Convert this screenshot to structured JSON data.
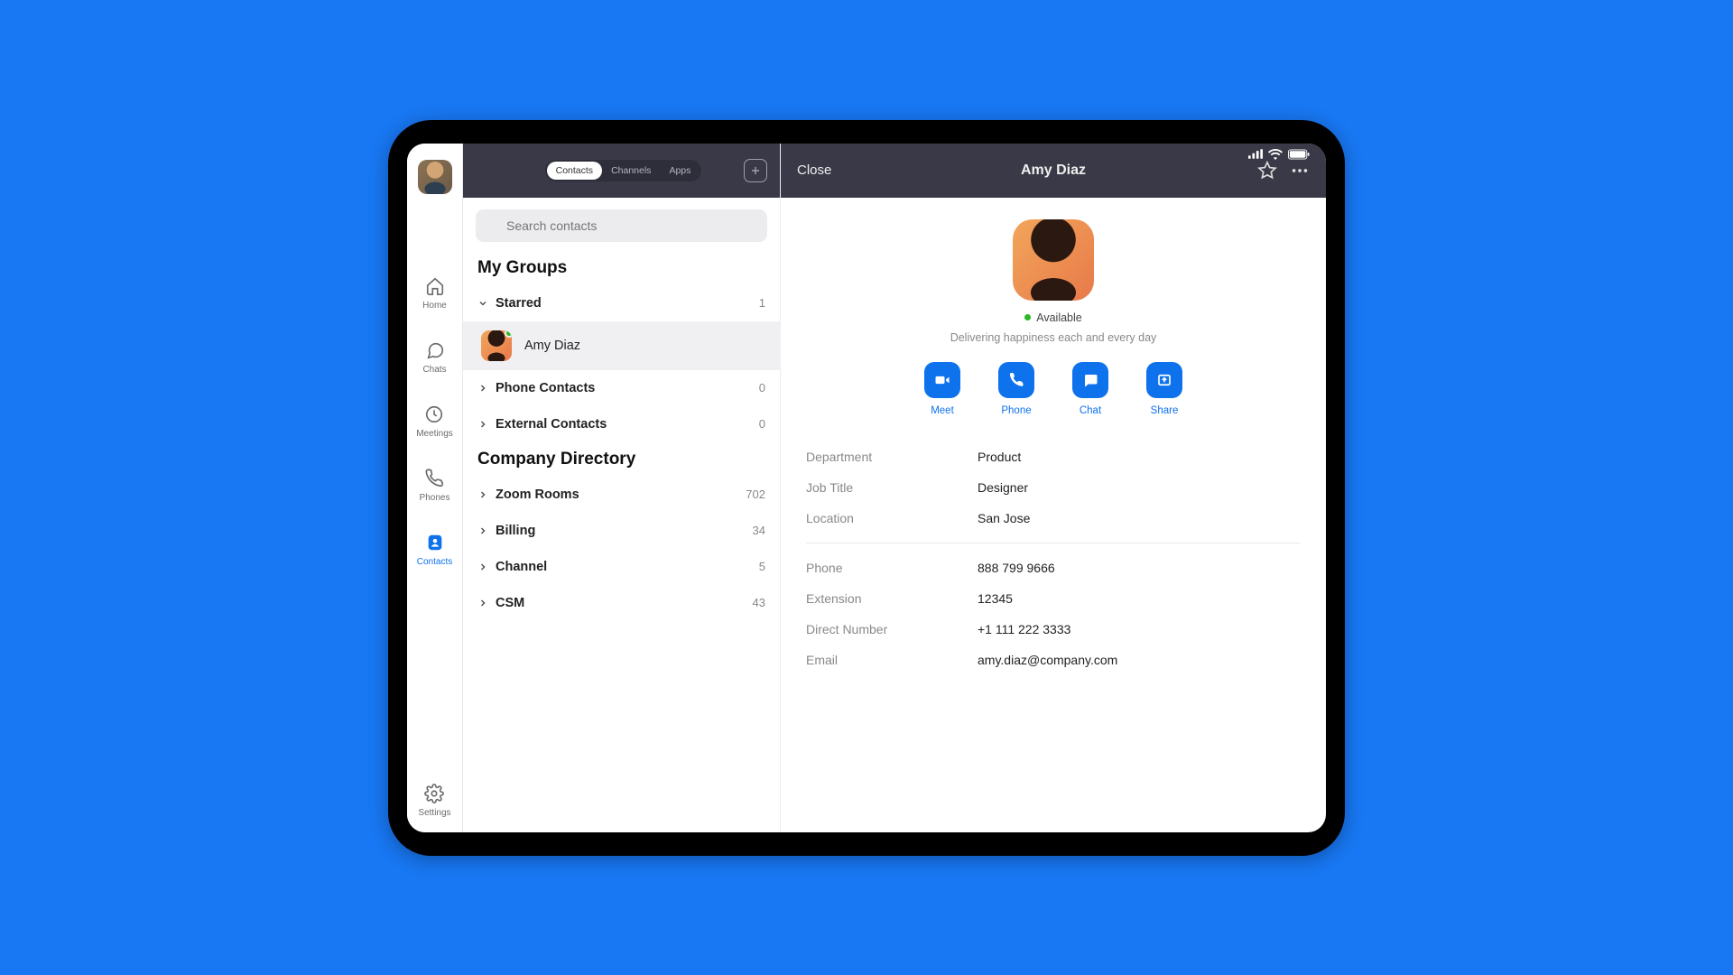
{
  "nav": {
    "items": [
      {
        "label": "Home"
      },
      {
        "label": "Chats"
      },
      {
        "label": "Meetings"
      },
      {
        "label": "Phones"
      },
      {
        "label": "Contacts"
      },
      {
        "label": "Settings"
      }
    ]
  },
  "contactsHeader": {
    "tabs": [
      "Contacts",
      "Channels",
      "Apps"
    ]
  },
  "search": {
    "placeholder": "Search contacts"
  },
  "sections": {
    "myGroups": "My Groups",
    "companyDirectory": "Company Directory"
  },
  "groups": {
    "starred": {
      "label": "Starred",
      "count": "1"
    },
    "phoneContacts": {
      "label": "Phone Contacts",
      "count": "0"
    },
    "externalContacts": {
      "label": "External Contacts",
      "count": "0"
    },
    "zoomRooms": {
      "label": "Zoom Rooms",
      "count": "702"
    },
    "billing": {
      "label": "Billing",
      "count": "34"
    },
    "channel": {
      "label": "Channel",
      "count": "5"
    },
    "csm": {
      "label": "CSM",
      "count": "43"
    }
  },
  "starredContact": {
    "name": "Amy Diaz"
  },
  "detail": {
    "close": "Close",
    "title": "Amy Diaz",
    "presence": "Available",
    "tagline": "Delivering happiness each and every day",
    "actions": {
      "meet": "Meet",
      "phone": "Phone",
      "chat": "Chat",
      "share": "Share"
    },
    "info": {
      "department": {
        "label": "Department",
        "value": "Product"
      },
      "jobTitle": {
        "label": "Job Title",
        "value": "Designer"
      },
      "location": {
        "label": "Location",
        "value": "San Jose"
      },
      "phone": {
        "label": "Phone",
        "value": "888 799 9666"
      },
      "extension": {
        "label": "Extension",
        "value": "12345"
      },
      "directNumber": {
        "label": "Direct Number",
        "value": "+1 111 222 3333"
      },
      "email": {
        "label": "Email",
        "value": "amy.diaz@company.com"
      }
    }
  }
}
